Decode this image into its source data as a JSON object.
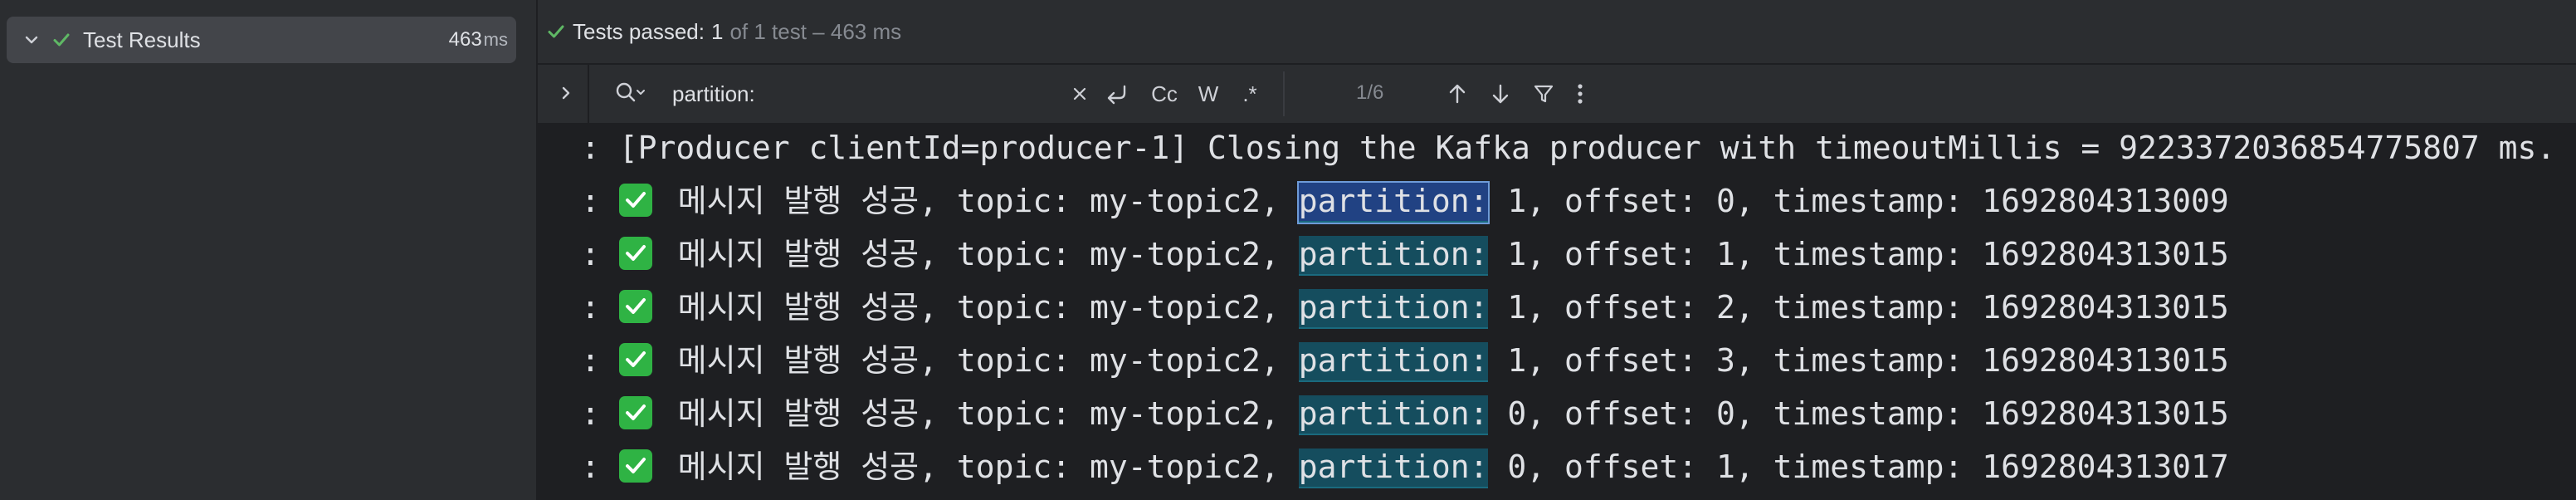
{
  "tree": {
    "root_label": "Test Results",
    "duration_value": "463",
    "duration_unit": "ms"
  },
  "status": {
    "passed_label": "Tests passed:",
    "passed_count": "1",
    "rest": "of 1 test – 463 ms"
  },
  "search": {
    "value": "partition:",
    "match_case_label": "Cc",
    "words_label": "W",
    "regex_label": ".*",
    "match_counter": "1/6"
  },
  "console": {
    "lines": [
      {
        "prefix": ": [Producer clientId=producer-1] Closing the Kafka producer with timeoutMillis = 9223372036854775807 ms."
      },
      {
        "prefix": ": ",
        "text_before": " 메시지 발행 성공, topic: my-topic2, ",
        "match": "partition:",
        "text_after": " 1, offset: 0, timestamp: 1692804313009"
      },
      {
        "prefix": ": ",
        "text_before": " 메시지 발행 성공, topic: my-topic2, ",
        "match": "partition:",
        "text_after": " 1, offset: 1, timestamp: 1692804313015"
      },
      {
        "prefix": ": ",
        "text_before": " 메시지 발행 성공, topic: my-topic2, ",
        "match": "partition:",
        "text_after": " 1, offset: 2, timestamp: 1692804313015"
      },
      {
        "prefix": ": ",
        "text_before": " 메시지 발행 성공, topic: my-topic2, ",
        "match": "partition:",
        "text_after": " 1, offset: 3, timestamp: 1692804313015"
      },
      {
        "prefix": ": ",
        "text_before": " 메시지 발행 성공, topic: my-topic2, ",
        "match": "partition:",
        "text_after": " 0, offset: 0, timestamp: 1692804313015"
      },
      {
        "prefix": ": ",
        "text_before": " 메시지 발행 성공, topic: my-topic2, ",
        "match": "partition:",
        "text_after": " 0, offset: 1, timestamp: 1692804313017"
      }
    ]
  },
  "colors": {
    "success_green": "#5fb865",
    "match_highlight": "#154d5e",
    "current_match": "#214283"
  }
}
